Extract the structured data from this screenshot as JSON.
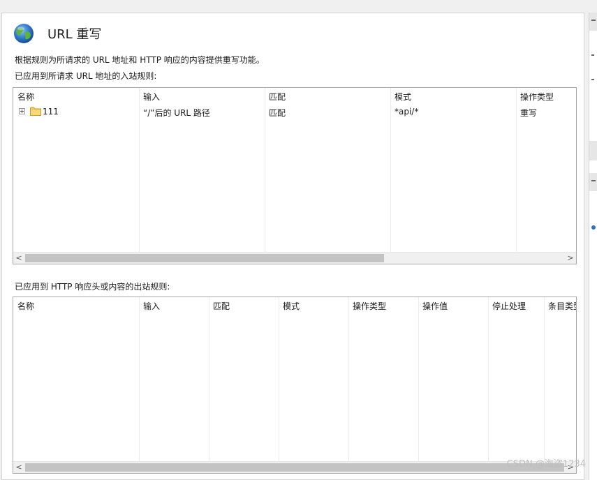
{
  "page": {
    "title": "URL 重写",
    "description": "根据规则为所请求的 URL 地址和 HTTP 响应的内容提供重写功能。"
  },
  "inbound": {
    "label": "已应用到所请求 URL 地址的入站规则:",
    "columns": [
      "名称",
      "输入",
      "匹配",
      "模式",
      "操作类型"
    ],
    "rows": [
      {
        "name": "111",
        "input": "“/”后的 URL 路径",
        "match": "匹配",
        "pattern": "*api/*",
        "action": "重写"
      }
    ]
  },
  "outbound": {
    "label": "已应用到 HTTP 响应头或内容的出站规则:",
    "columns": [
      "名称",
      "输入",
      "匹配",
      "模式",
      "操作类型",
      "操作值",
      "停止处理",
      "条目类型"
    ]
  },
  "scrollbar": {
    "left_arrow": "<",
    "right_arrow": ">"
  },
  "watermark": "CSDN @海盗1234",
  "icons": {
    "page": "globe-icon",
    "expander": "plus-box-icon",
    "rule": "folder-icon"
  },
  "colors": {
    "grid_border": "#a8a8a8",
    "scroll_thumb": "#c3c3c3",
    "folder": "#f3c85a",
    "globe_ocean": "#2f78c9",
    "globe_land": "#5fb23a"
  }
}
